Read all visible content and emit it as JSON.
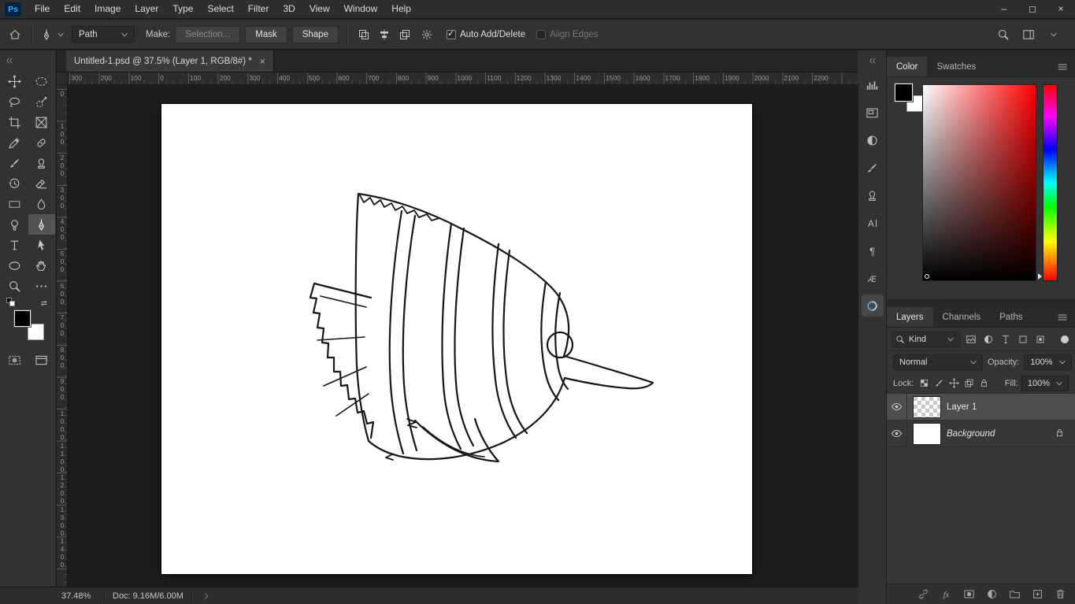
{
  "app": {
    "logo": "Ps"
  },
  "menubar": {
    "items": [
      {
        "name": "menu-file",
        "label": "File"
      },
      {
        "name": "menu-edit",
        "label": "Edit"
      },
      {
        "name": "menu-image",
        "label": "Image"
      },
      {
        "name": "menu-layer",
        "label": "Layer"
      },
      {
        "name": "menu-type",
        "label": "Type"
      },
      {
        "name": "menu-select",
        "label": "Select"
      },
      {
        "name": "menu-filter",
        "label": "Filter"
      },
      {
        "name": "menu-3d",
        "label": "3D"
      },
      {
        "name": "menu-view",
        "label": "View"
      },
      {
        "name": "menu-window",
        "label": "Window"
      },
      {
        "name": "menu-help",
        "label": "Help"
      }
    ],
    "window_controls": [
      {
        "name": "minimize-button",
        "glyph": "–"
      },
      {
        "name": "restore-button",
        "glyph": "◻"
      },
      {
        "name": "close-button",
        "glyph": "×"
      }
    ]
  },
  "options_bar": {
    "preset_value": "Path",
    "make_label": "Make:",
    "buttons": {
      "selection": "Selection...",
      "mask": "Mask",
      "shape": "Shape"
    },
    "path_icons": [
      {
        "name": "path-operations-icon",
        "icon": "i-pathops"
      },
      {
        "name": "path-alignment-icon",
        "icon": "i-pathalign"
      },
      {
        "name": "path-arrangement-icon",
        "icon": "i-patharrange"
      }
    ],
    "auto_add_delete_label": "Auto Add/Delete",
    "align_edges_label": "Align Edges"
  },
  "document_tab": {
    "title": "Untitled-1.psd @ 37.5% (Layer 1, RGB/8#) *",
    "close_glyph": "×"
  },
  "toolbar": {
    "tools": [
      {
        "name": "move-tool",
        "icon": "i-move"
      },
      {
        "name": "marquee-tool",
        "icon": "i-marquee"
      },
      {
        "name": "lasso-tool",
        "icon": "i-lasso"
      },
      {
        "name": "quick-selection-tool",
        "icon": "i-quickselect"
      },
      {
        "name": "crop-tool",
        "icon": "i-crop"
      },
      {
        "name": "frame-tool",
        "icon": "i-frame"
      },
      {
        "name": "eyedropper-tool",
        "icon": "i-eyedropper"
      },
      {
        "name": "spot-healing-tool",
        "icon": "i-healing"
      },
      {
        "name": "brush-tool",
        "icon": "i-brush"
      },
      {
        "name": "clone-stamp-tool",
        "icon": "i-clone"
      },
      {
        "name": "history-brush-tool",
        "icon": "i-history"
      },
      {
        "name": "eraser-tool",
        "icon": "i-eraser"
      },
      {
        "name": "gradient-tool",
        "icon": "i-gradient"
      },
      {
        "name": "blur-tool",
        "icon": "i-blur"
      },
      {
        "name": "dodge-tool",
        "icon": "i-dodge"
      },
      {
        "name": "pen-tool",
        "icon": "i-pen",
        "selected": true
      },
      {
        "name": "type-tool",
        "icon": "i-type"
      },
      {
        "name": "path-selection-tool",
        "icon": "i-pathselect"
      },
      {
        "name": "ellipse-tool",
        "icon": "i-ellipse"
      },
      {
        "name": "hand-tool",
        "icon": "i-hand"
      },
      {
        "name": "zoom-tool",
        "icon": "i-zoom"
      },
      {
        "name": "edit-toolbar-button",
        "icon": "i-more"
      }
    ]
  },
  "rulers": {
    "horizontal": [
      "300",
      "200",
      "100",
      "0",
      "100",
      "200",
      "300",
      "400",
      "500",
      "600",
      "700",
      "800",
      "900",
      "1000",
      "1100",
      "1200",
      "1300",
      "1400",
      "1500",
      "1600",
      "1700",
      "1800",
      "1900",
      "2000",
      "2100",
      "2200"
    ],
    "vertical": [
      "0",
      "100",
      "200",
      "300",
      "400",
      "500",
      "600",
      "700",
      "800",
      "900",
      "1000",
      "1100",
      "1200",
      "1300",
      "1400"
    ]
  },
  "dock": {
    "icons": [
      {
        "name": "histogram-panel",
        "icon": "i-histogram"
      },
      {
        "name": "navigator-panel",
        "icon": "i-navigator"
      },
      {
        "name": "adjustments-panel",
        "icon": "i-adjust"
      },
      {
        "name": "brush-settings-panel",
        "icon": "i-brush"
      },
      {
        "name": "clone-source-panel",
        "icon": "i-clone"
      },
      {
        "name": "character-panel",
        "icon": "i-character"
      },
      {
        "name": "paragraph-panel",
        "icon": "i-paragraph"
      },
      {
        "name": "glyphs-panel",
        "icon": "i-glyphs"
      },
      {
        "name": "libraries-panel",
        "icon": "i-libraries",
        "selected": true
      }
    ]
  },
  "color_panel": {
    "tabs": [
      {
        "name": "tab-color",
        "label": "Color",
        "active": true
      },
      {
        "name": "tab-swatches",
        "label": "Swatches"
      }
    ]
  },
  "layers_panel": {
    "tabs": [
      {
        "name": "tab-layers",
        "label": "Layers",
        "active": true
      },
      {
        "name": "tab-channels",
        "label": "Channels"
      },
      {
        "name": "tab-paths",
        "label": "Paths"
      }
    ],
    "kind_value": "Kind",
    "filter_icons": [
      {
        "name": "filter-pixel-layers-icon",
        "icon": "i-fpixel"
      },
      {
        "name": "filter-adjustment-layers-icon",
        "icon": "i-adjust"
      },
      {
        "name": "filter-type-layers-icon",
        "icon": "i-type"
      },
      {
        "name": "filter-shape-layers-icon",
        "icon": "i-fshape"
      },
      {
        "name": "filter-smart-objects-icon",
        "icon": "i-fsmart"
      }
    ],
    "blend_mode_value": "Normal",
    "opacity_label": "Opacity:",
    "opacity_value": "100%",
    "lock_label": "Lock:",
    "lock_icons": [
      {
        "name": "lock-transparent-pixels-icon",
        "icon": "i-checker"
      },
      {
        "name": "lock-image-pixels-icon",
        "icon": "i-brush"
      },
      {
        "name": "lock-position-icon",
        "icon": "i-move"
      },
      {
        "name": "lock-artboard-icon",
        "icon": "i-patharrange"
      },
      {
        "name": "lock-all-icon",
        "icon": "i-lockicon"
      }
    ],
    "fill_label": "Fill:",
    "fill_value": "100%",
    "layers": [
      {
        "name": "layer-row-layer-1",
        "label": "Layer 1",
        "selected": true,
        "thumb": "checker"
      },
      {
        "name": "layer-row-background",
        "label": "Background",
        "thumb": "white",
        "locked": true,
        "italic": true
      }
    ],
    "bottom_icons": [
      {
        "name": "link-layers-icon",
        "icon": "i-link"
      },
      {
        "name": "layer-style-fx-icon",
        "icon": "i-fx"
      },
      {
        "name": "add-layer-mask-icon",
        "icon": "i-mask"
      },
      {
        "name": "new-adjustment-layer-icon",
        "icon": "i-adjust"
      },
      {
        "name": "new-group-icon",
        "icon": "i-folder"
      },
      {
        "name": "new-layer-icon",
        "icon": "i-newlayer"
      },
      {
        "name": "delete-layer-icon",
        "icon": "i-trash"
      }
    ]
  },
  "status_bar": {
    "zoom": "37.48%",
    "doc_info": "Doc: 9.16M/6.00M"
  }
}
